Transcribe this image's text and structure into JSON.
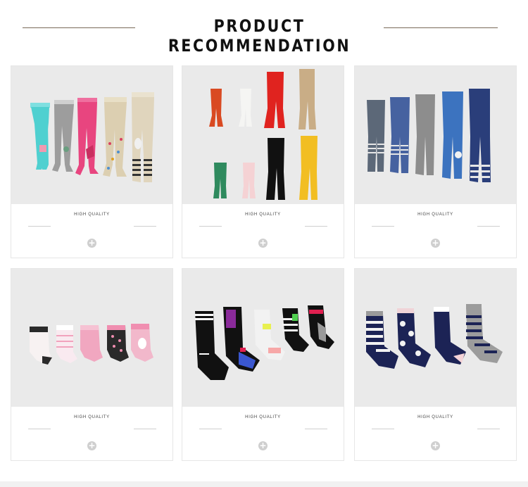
{
  "header": {
    "title": "PRODUCT RECOMMENDATION",
    "rule_color": "#7a6a58"
  },
  "products": [
    {
      "caption": "HIGH QUALITY",
      "image": "children-tights-assorted-prints-image",
      "action_icon": "plus-icon"
    },
    {
      "caption": "HIGH QUALITY",
      "image": "children-tights-solid-colors-image",
      "action_icon": "plus-icon"
    },
    {
      "caption": "HIGH QUALITY",
      "image": "children-tights-denim-striped-image",
      "action_icon": "plus-icon"
    },
    {
      "caption": "HIGH QUALITY",
      "image": "baby-socks-pink-image",
      "action_icon": "plus-icon"
    },
    {
      "caption": "HIGH QUALITY",
      "image": "kids-sport-crew-socks-image",
      "action_icon": "plus-icon"
    },
    {
      "caption": "HIGH QUALITY",
      "image": "kids-navy-striped-socks-image",
      "action_icon": "plus-icon"
    }
  ],
  "colors": {
    "image_background": "#eaeaea",
    "plus_button": "#cfcfcf",
    "caption_text": "#444444"
  }
}
